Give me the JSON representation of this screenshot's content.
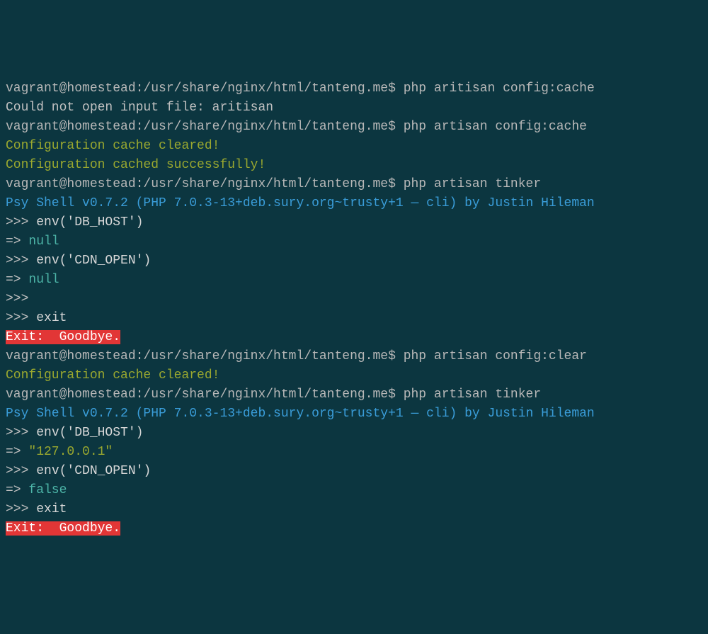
{
  "lines": {
    "l1_prompt": "vagrant@homestead:/usr/share/nginx/html/tanteng.me$ ",
    "l1_cmd": "php aritisan config:cache",
    "l2": "Could not open input file: aritisan",
    "l3_prompt": "vagrant@homestead:/usr/share/nginx/html/tanteng.me$ ",
    "l3_cmd": "php artisan config:cache",
    "l4": "Configuration cache cleared!",
    "l5": "Configuration cached successfully!",
    "l6_prompt": "vagrant@homestead:/usr/share/nginx/html/tanteng.me$ ",
    "l6_cmd": "php artisan tinker",
    "l7": "Psy Shell v0.7.2 (PHP 7.0.3-13+deb.sury.org~trusty+1 — cli) by Justin Hileman",
    "l8_repl": ">>> ",
    "l8_cmd": "env('DB_HOST')",
    "l9_arrow": "=> ",
    "l9_val": "null",
    "l10_repl": ">>> ",
    "l10_cmd": "env('CDN_OPEN')",
    "l11_arrow": "=> ",
    "l11_val": "null",
    "l12_repl": ">>>",
    "l13_repl": ">>> ",
    "l13_cmd": "exit",
    "l14": "Exit:  Goodbye.",
    "l15_prompt": "vagrant@homestead:/usr/share/nginx/html/tanteng.me$ ",
    "l15_cmd": "php artisan config:clear",
    "l16": "Configuration cache cleared!",
    "l17_prompt": "vagrant@homestead:/usr/share/nginx/html/tanteng.me$ ",
    "l17_cmd": "php artisan tinker",
    "l18": "Psy Shell v0.7.2 (PHP 7.0.3-13+deb.sury.org~trusty+1 — cli) by Justin Hileman",
    "l19_repl": ">>> ",
    "l19_cmd": "env('DB_HOST')",
    "l20_arrow": "=> ",
    "l20_val": "\"127.0.0.1\"",
    "l21_repl": ">>> ",
    "l21_cmd": "env('CDN_OPEN')",
    "l22_arrow": "=> ",
    "l22_val": "false",
    "l23_repl": ">>> ",
    "l23_cmd": "exit",
    "l24": "Exit:  Goodbye."
  }
}
